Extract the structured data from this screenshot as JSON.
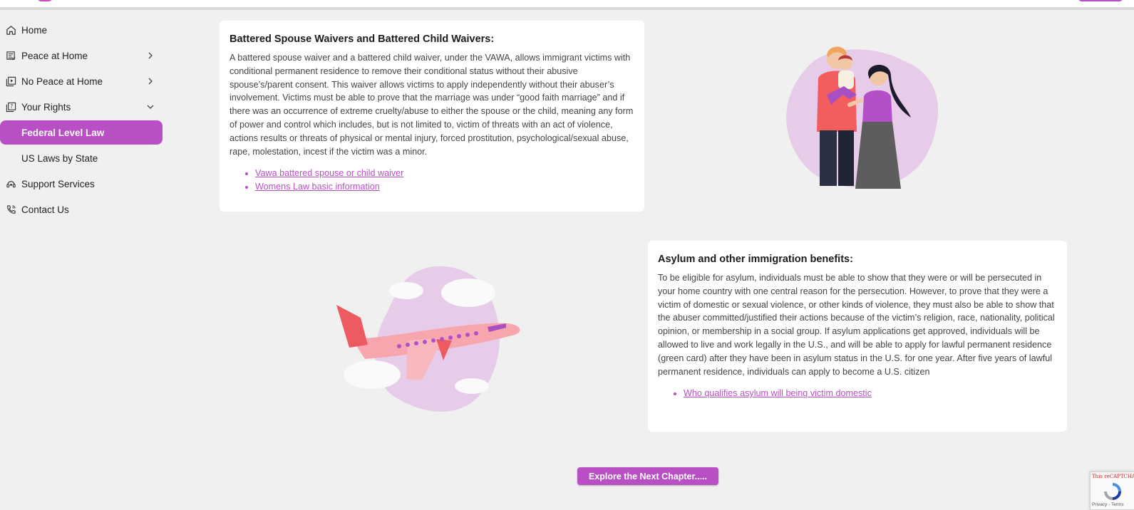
{
  "sidebar": {
    "items": [
      {
        "label": "Home",
        "icon": "home-icon"
      },
      {
        "label": "Peace at Home",
        "icon": "peace-icon"
      },
      {
        "label": "No Peace at Home",
        "icon": "no-peace-icon"
      },
      {
        "label": "Your Rights",
        "icon": "rights-icon"
      },
      {
        "label": "Federal Level Law"
      },
      {
        "label": "US Laws by State"
      },
      {
        "label": "Support Services",
        "icon": "support-icon"
      },
      {
        "label": "Contact Us",
        "icon": "phone-icon"
      }
    ],
    "active_color": "#b84fc4"
  },
  "section1": {
    "title": "Battered Spouse Waivers and Battered Child Waivers:",
    "body": "A battered spouse waiver and a battered child waiver, under the VAWA, allows immigrant victims with conditional permanent residence to remove their conditional status without their abusive spouse’s/parent consent. This waiver allows victims to apply independently without their abuser’s involvement. Victims must be able to prove that the marriage was under “good faith marriage” and if there was an occurrence of extreme cruelty/abuse to either the spouse or the child, meaning any form of power and control which includes, but is not limited to, victim of threats with an act of violence, actions results or threats of physical or mental injury, forced prostitution, psychological/sexual abuse, rape, molestation, incest if the victim was a minor.",
    "links": [
      "Vawa battered spouse or child waiver",
      "Womens Law basic information"
    ]
  },
  "section2": {
    "title": "Asylum and other immigration benefits:",
    "body": "To be eligible for asylum, individuals must be able to show that they were or will be persecuted in your home country with one central reason for the persecution. However, to prove that they were a victim of domestic or sexual violence, or other kinds of violence, they must also be able to show that the abuser committed/justified their actions because of the victim’s religion, race, nationality, political opinion, or membership in a social group. If asylum applications get approved, individuals will be allowed to live and work legally in the U.S., and will be able to apply for lawful permanent residence (green card) after they have been in asylum status in the U.S. for one year. After five years of lawful permanent residence, individuals can apply to become a U.S. citizen",
    "links": [
      "Who qualifies asylum will being victim domestic"
    ]
  },
  "explore_button": "Explore the Next Chapter.....",
  "recaptcha": {
    "warning": "This reCAPTCHA site",
    "terms": "Privacy - Terms"
  }
}
